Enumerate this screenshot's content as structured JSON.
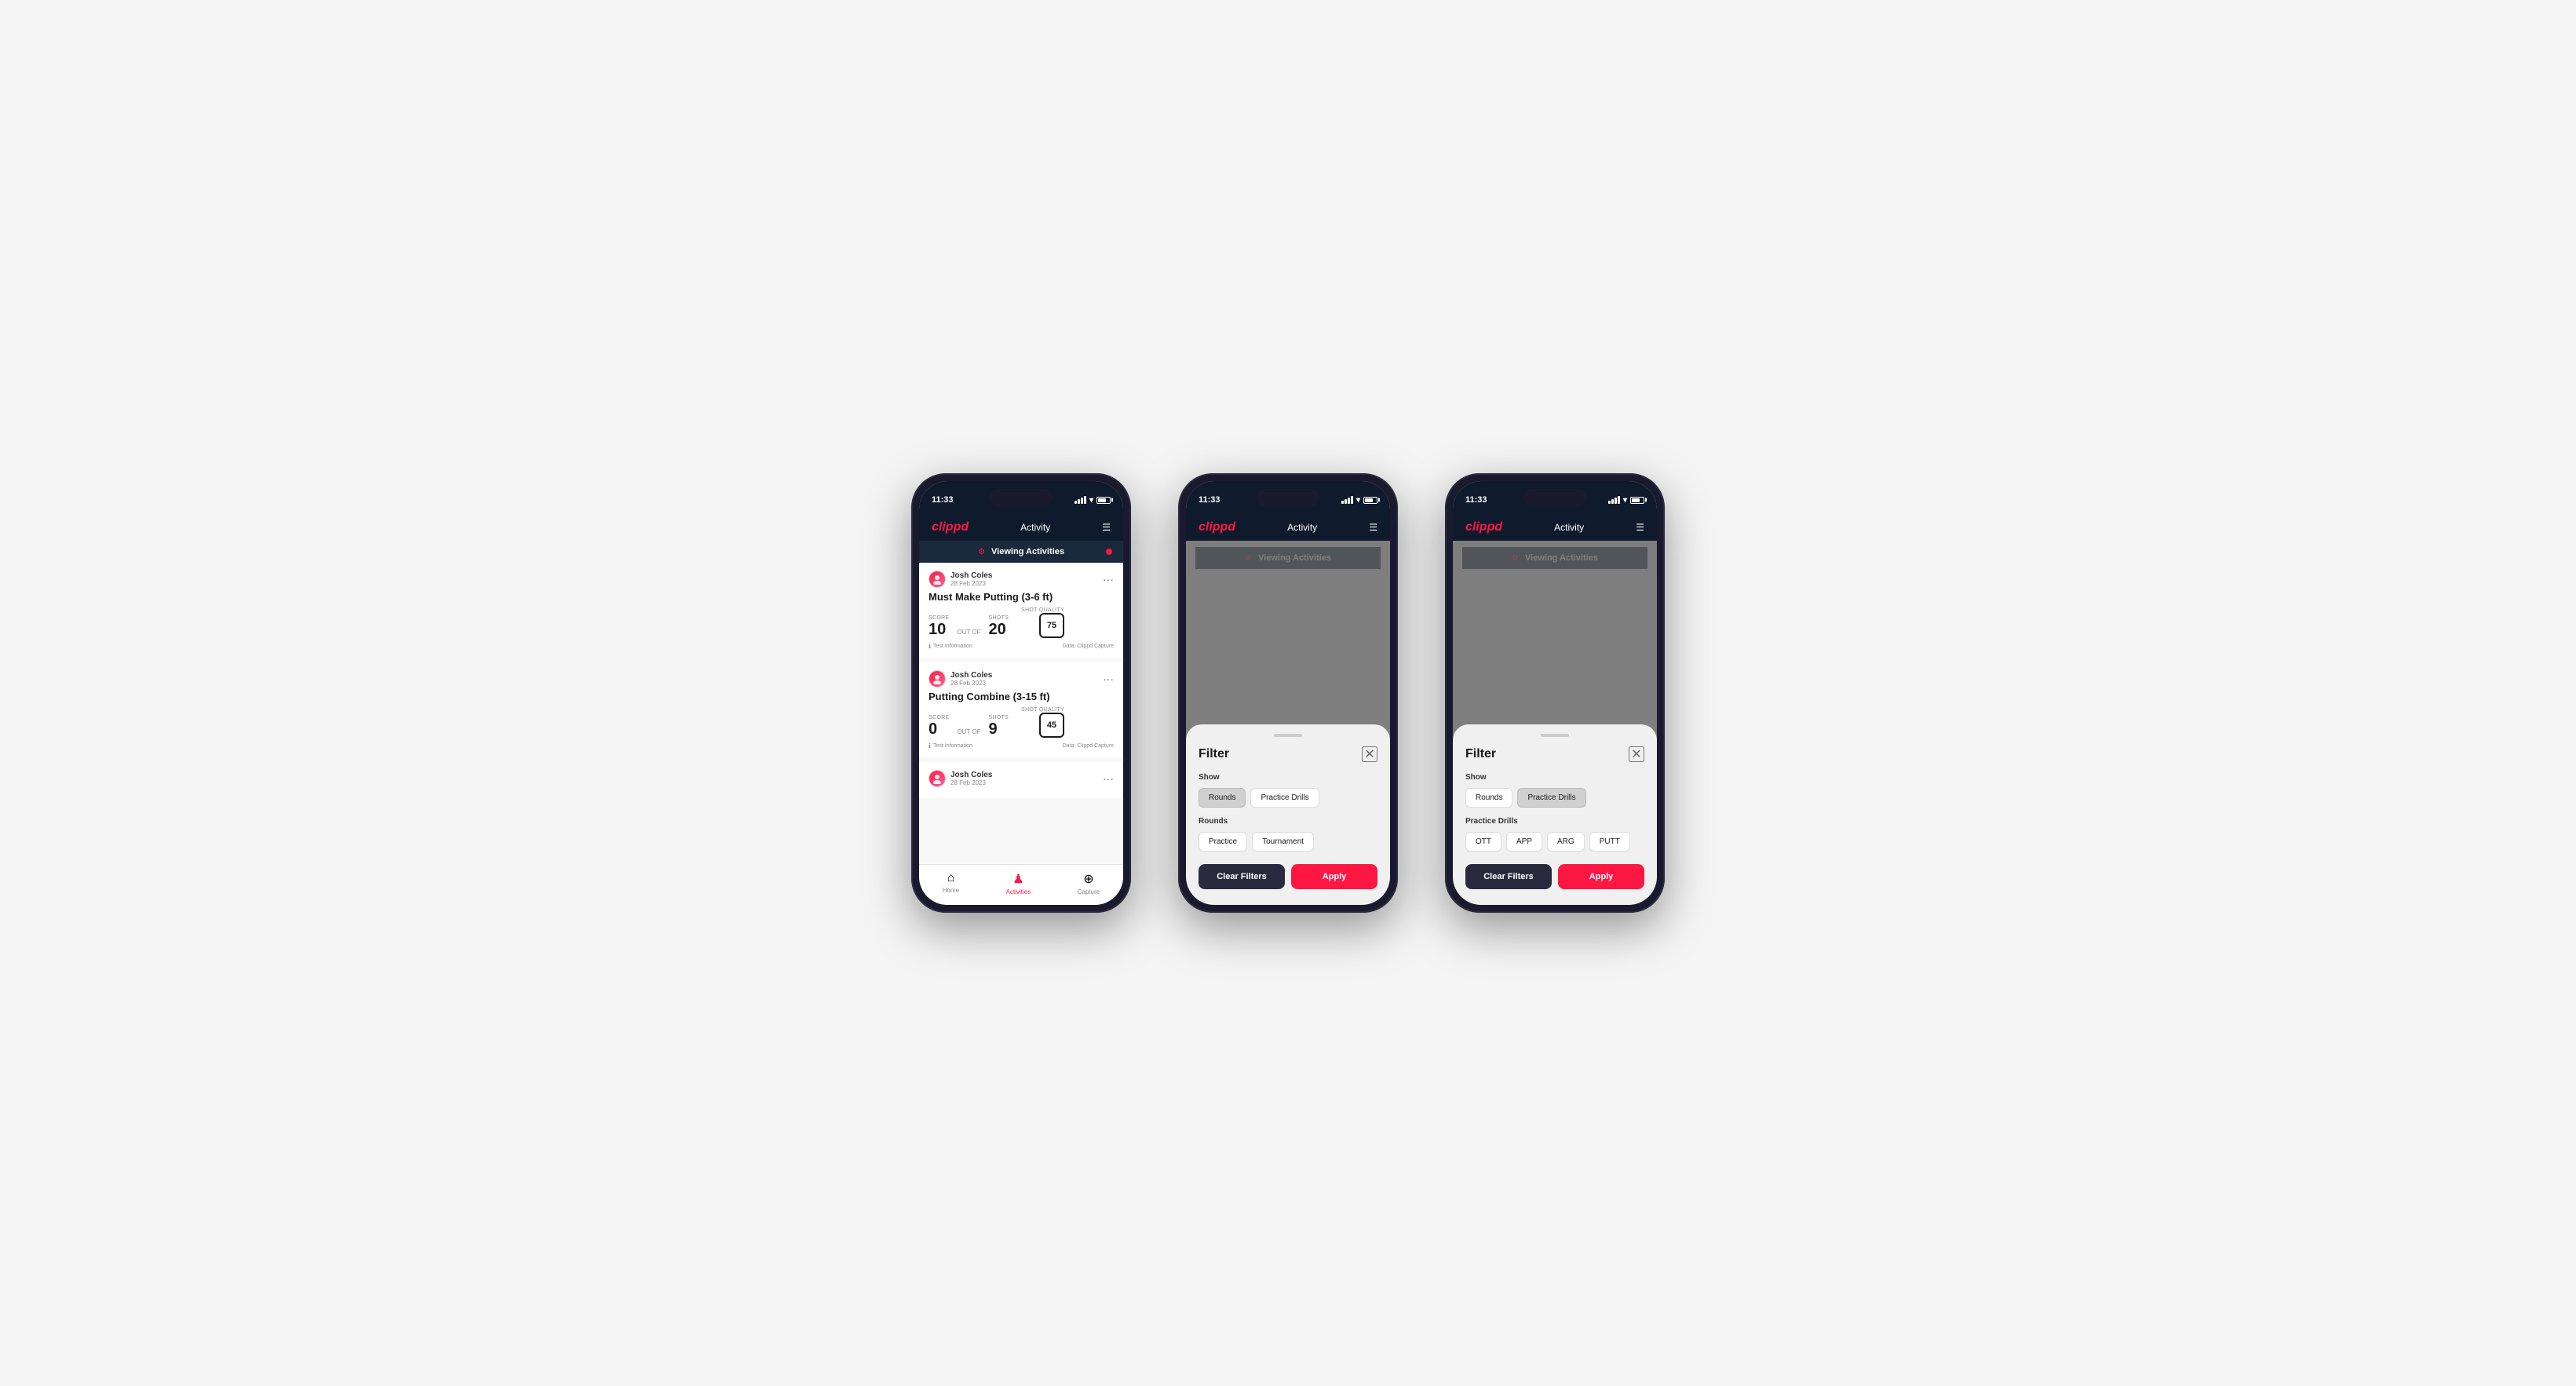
{
  "app": {
    "name": "clippd",
    "screen_title": "Activity",
    "status_time": "11:33"
  },
  "phone1": {
    "viewing_bar": "Viewing Activities",
    "activities": [
      {
        "user": "Josh Coles",
        "date": "28 Feb 2023",
        "title": "Must Make Putting (3-6 ft)",
        "score_label": "Score",
        "score": "10",
        "out_of_label": "OUT OF",
        "shots_label": "Shots",
        "shots": "20",
        "shot_quality_label": "Shot Quality",
        "shot_quality": "75",
        "test_info": "Test Information",
        "data_source": "Data: Clippd Capture"
      },
      {
        "user": "Josh Coles",
        "date": "28 Feb 2023",
        "title": "Putting Combine (3-15 ft)",
        "score_label": "Score",
        "score": "0",
        "out_of_label": "OUT OF",
        "shots_label": "Shots",
        "shots": "9",
        "shot_quality_label": "Shot Quality",
        "shot_quality": "45",
        "test_info": "Test Information",
        "data_source": "Data: Clippd Capture"
      },
      {
        "user": "Josh Coles",
        "date": "28 Feb 2023",
        "title": "",
        "score": "",
        "shots": "",
        "shot_quality": ""
      }
    ],
    "nav": {
      "home": "Home",
      "activities": "Activities",
      "capture": "Capture"
    }
  },
  "phone2": {
    "filter": {
      "title": "Filter",
      "show_label": "Show",
      "rounds_btn": "Rounds",
      "practice_drills_btn": "Practice Drills",
      "rounds_section_label": "Rounds",
      "practice_btn": "Practice",
      "tournament_btn": "Tournament",
      "clear_filters_btn": "Clear Filters",
      "apply_btn": "Apply",
      "rounds_active": true,
      "practice_drills_active": false,
      "practice_active": false,
      "tournament_active": false
    }
  },
  "phone3": {
    "filter": {
      "title": "Filter",
      "show_label": "Show",
      "rounds_btn": "Rounds",
      "practice_drills_btn": "Practice Drills",
      "practice_drills_section_label": "Practice Drills",
      "ott_btn": "OTT",
      "app_btn": "APP",
      "arg_btn": "ARG",
      "putt_btn": "PUTT",
      "clear_filters_btn": "Clear Filters",
      "apply_btn": "Apply",
      "rounds_active": false,
      "practice_drills_active": true
    }
  }
}
